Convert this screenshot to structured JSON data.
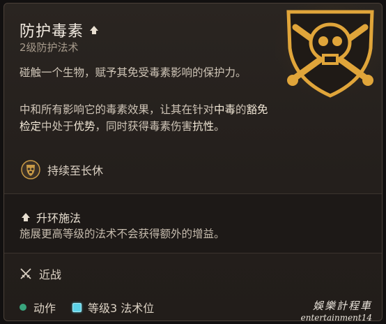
{
  "tooltip": {
    "title": "防护毒素",
    "subtitle": "2级防护法术",
    "description_1": "碰触一个生物，赋予其免受毒素影响的保护力。",
    "description_2_parts": [
      "中和所有影响它的毒素效果，让其在针对",
      "中毒",
      "的",
      "豁免检定",
      "中处于",
      "优势",
      "，同时获得毒素伤害",
      "抗性",
      "。"
    ],
    "duration": {
      "icon": "long-rest-icon",
      "label": "持续至长休"
    },
    "upcast": {
      "icon": "upcast-icon",
      "label": "升环施法",
      "description": "施展更高等级的法术不会获得额外的增益。"
    },
    "range": {
      "icon": "melee-swords-icon",
      "label": "近战"
    },
    "cost": {
      "action_label": "动作",
      "action_color": "#39a47d",
      "slot_label": "等级3 法术位",
      "slot_color": "#5cd2e8"
    },
    "emblem": {
      "icon": "poison-skull-shield-icon",
      "color": "#e0a53a"
    }
  },
  "watermark": {
    "line1": "娛樂計程車",
    "line2": "entertainment14"
  }
}
